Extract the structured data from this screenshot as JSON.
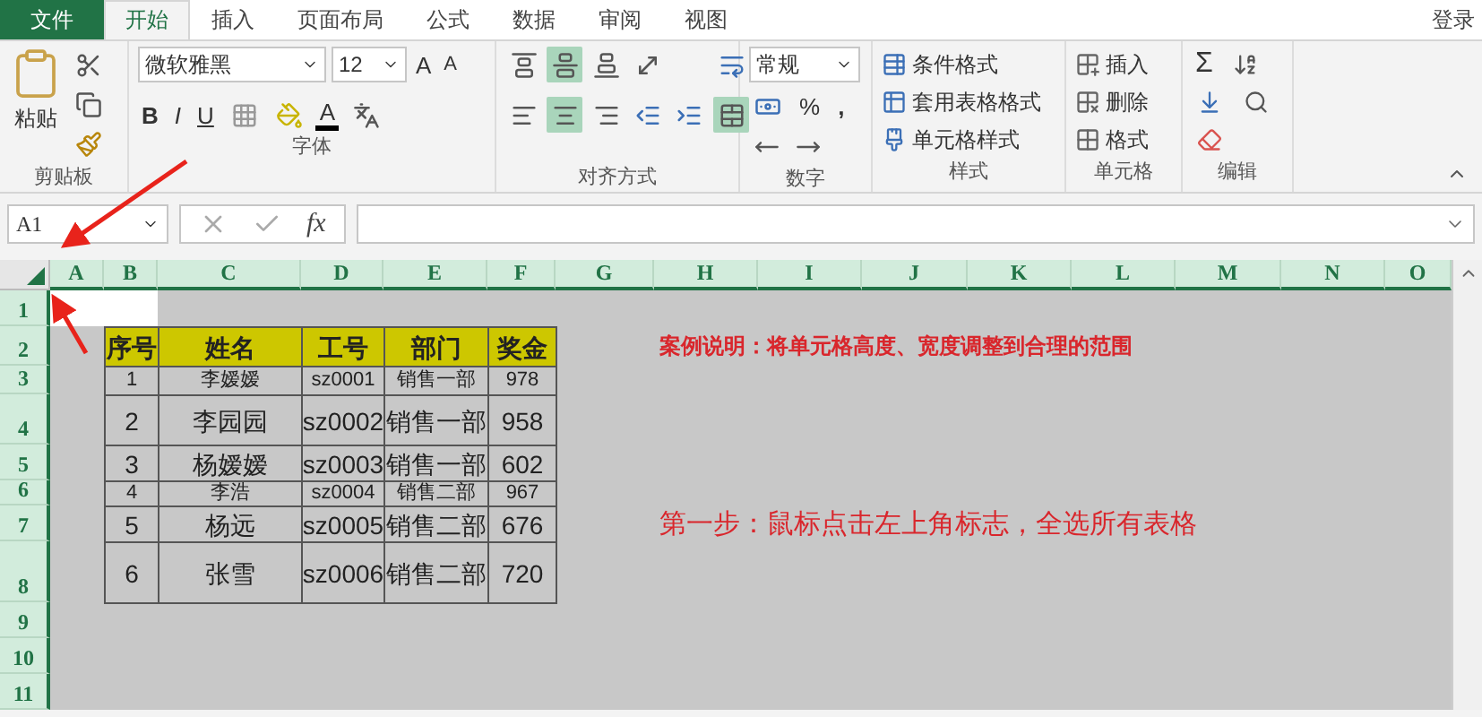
{
  "tabs": [
    {
      "label": "文件",
      "kind": "file",
      "selected": false
    },
    {
      "label": "开始",
      "kind": "tab",
      "selected": true
    },
    {
      "label": "插入",
      "kind": "tab",
      "selected": false
    },
    {
      "label": "页面布局",
      "kind": "tab",
      "selected": false
    },
    {
      "label": "公式",
      "kind": "tab",
      "selected": false
    },
    {
      "label": "数据",
      "kind": "tab",
      "selected": false
    },
    {
      "label": "审阅",
      "kind": "tab",
      "selected": false
    },
    {
      "label": "视图",
      "kind": "tab",
      "selected": false
    }
  ],
  "account": "登录",
  "ribbon": {
    "groups": [
      {
        "kind": "clipboard",
        "label": "剪贴板",
        "paste": "粘贴"
      },
      {
        "kind": "font",
        "label": "字体",
        "font_name": "微软雅黑",
        "font_size": "12",
        "grow": "A",
        "shrink": "A",
        "bold": "B",
        "italic": "I",
        "underline": "U",
        "font_color": "A"
      },
      {
        "kind": "alignment",
        "label": "对齐方式",
        "top_row": [
          {
            "selected": false
          },
          {
            "selected": true
          },
          {
            "selected": false
          }
        ],
        "bottom_row": [
          {
            "selected": false
          },
          {
            "selected": true
          },
          {
            "selected": false
          }
        ],
        "merge_selected": true
      },
      {
        "kind": "number",
        "label": "数字",
        "format": "常规",
        "percent": "%",
        "comma": ","
      },
      {
        "kind": "styles",
        "label": "样式",
        "items": [
          "条件格式",
          "套用表格格式",
          "单元格样式"
        ]
      },
      {
        "kind": "cells",
        "label": "单元格",
        "items": [
          "插入",
          "删除",
          "格式"
        ]
      },
      {
        "kind": "editing",
        "label": "编辑",
        "sum": "Σ"
      }
    ]
  },
  "formula_bar": {
    "name_box": "A1",
    "fx": "fx"
  },
  "sheet": {
    "all_selected": true,
    "columns": [
      "A",
      "B",
      "C",
      "D",
      "E",
      "F",
      "G",
      "H",
      "I",
      "J",
      "K",
      "L",
      "M",
      "N",
      "O"
    ],
    "rows": [
      "1",
      "2",
      "3",
      "4",
      "5",
      "6",
      "7",
      "8",
      "9",
      "10",
      "11"
    ],
    "table": {
      "header": [
        "序号",
        "姓名",
        "工号",
        "部门",
        "奖金"
      ],
      "rows": [
        [
          "1",
          "李嫒嫒",
          "sz0001",
          "销售一部",
          "978"
        ],
        [
          "2",
          "李园园",
          "sz0002",
          "销售一部",
          "958"
        ],
        [
          "3",
          "杨嫒嫒",
          "sz0003",
          "销售一部",
          "602"
        ],
        [
          "4",
          "李浩",
          "sz0004",
          "销售二部",
          "967"
        ],
        [
          "5",
          "杨远",
          "sz0005",
          "销售二部",
          "676"
        ],
        [
          "6",
          "张雪",
          "sz0006",
          "销售二部",
          "720"
        ]
      ]
    },
    "notes": [
      {
        "kind": "title",
        "text": "案例说明：将单元格高度、宽度调整到合理的范围"
      },
      {
        "kind": "step",
        "text": "第一步：鼠标点击左上角标志，全选所有表格"
      }
    ]
  }
}
